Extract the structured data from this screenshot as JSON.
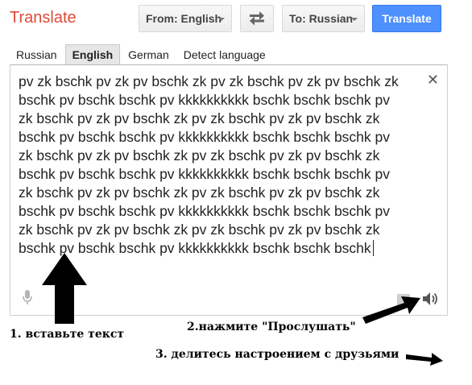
{
  "app_title": "Translate",
  "toolbar": {
    "from_label": "From: English",
    "to_label": "To: Russian",
    "translate_label": "Translate"
  },
  "lang_tabs": [
    {
      "label": "Russian",
      "active": false
    },
    {
      "label": "English",
      "active": true
    },
    {
      "label": "German",
      "active": false
    },
    {
      "label": "Detect language",
      "active": false
    }
  ],
  "source": {
    "lines": [
      "pv zk bschk pv zk pv bschk zk pv zk bschk pv zk pv bschk zk",
      "bschk pv bschk bschk pv kkkkkkkkkk bschk bschk bschk pv",
      "zk bschk pv zk pv bschk zk pv zk bschk pv zk pv bschk zk",
      "bschk pv bschk bschk pv kkkkkkkkkk bschk bschk bschk pv",
      "zk bschk pv zk pv bschk zk pv zk bschk pv zk pv bschk zk",
      "bschk pv bschk bschk pv kkkkkkkkkk bschk bschk bschk pv",
      "zk bschk pv zk pv bschk zk pv zk bschk pv zk pv bschk zk",
      "bschk pv bschk bschk pv kkkkkkkkkk bschk bschk bschk pv",
      "zk bschk pv zk pv bschk zk pv zk bschk pv zk pv bschk zk",
      "bschk pv bschk bschk pv kkkkkkkkkk bschk bschk bschk"
    ],
    "clear_symbol": "✕"
  },
  "annotations": {
    "step1": "1. вставьте текст",
    "step2": "2.нажмите \"Прослушать\"",
    "step3": "3. делитесь настроением с друзьями"
  },
  "icons": {
    "mic": "microphone-icon",
    "speaker": "speaker-icon",
    "swap": "swap-arrows-icon"
  },
  "colors": {
    "title": "#dd4b39",
    "translate_button": "#4d90fe",
    "annotation_arrow": "#000000"
  }
}
